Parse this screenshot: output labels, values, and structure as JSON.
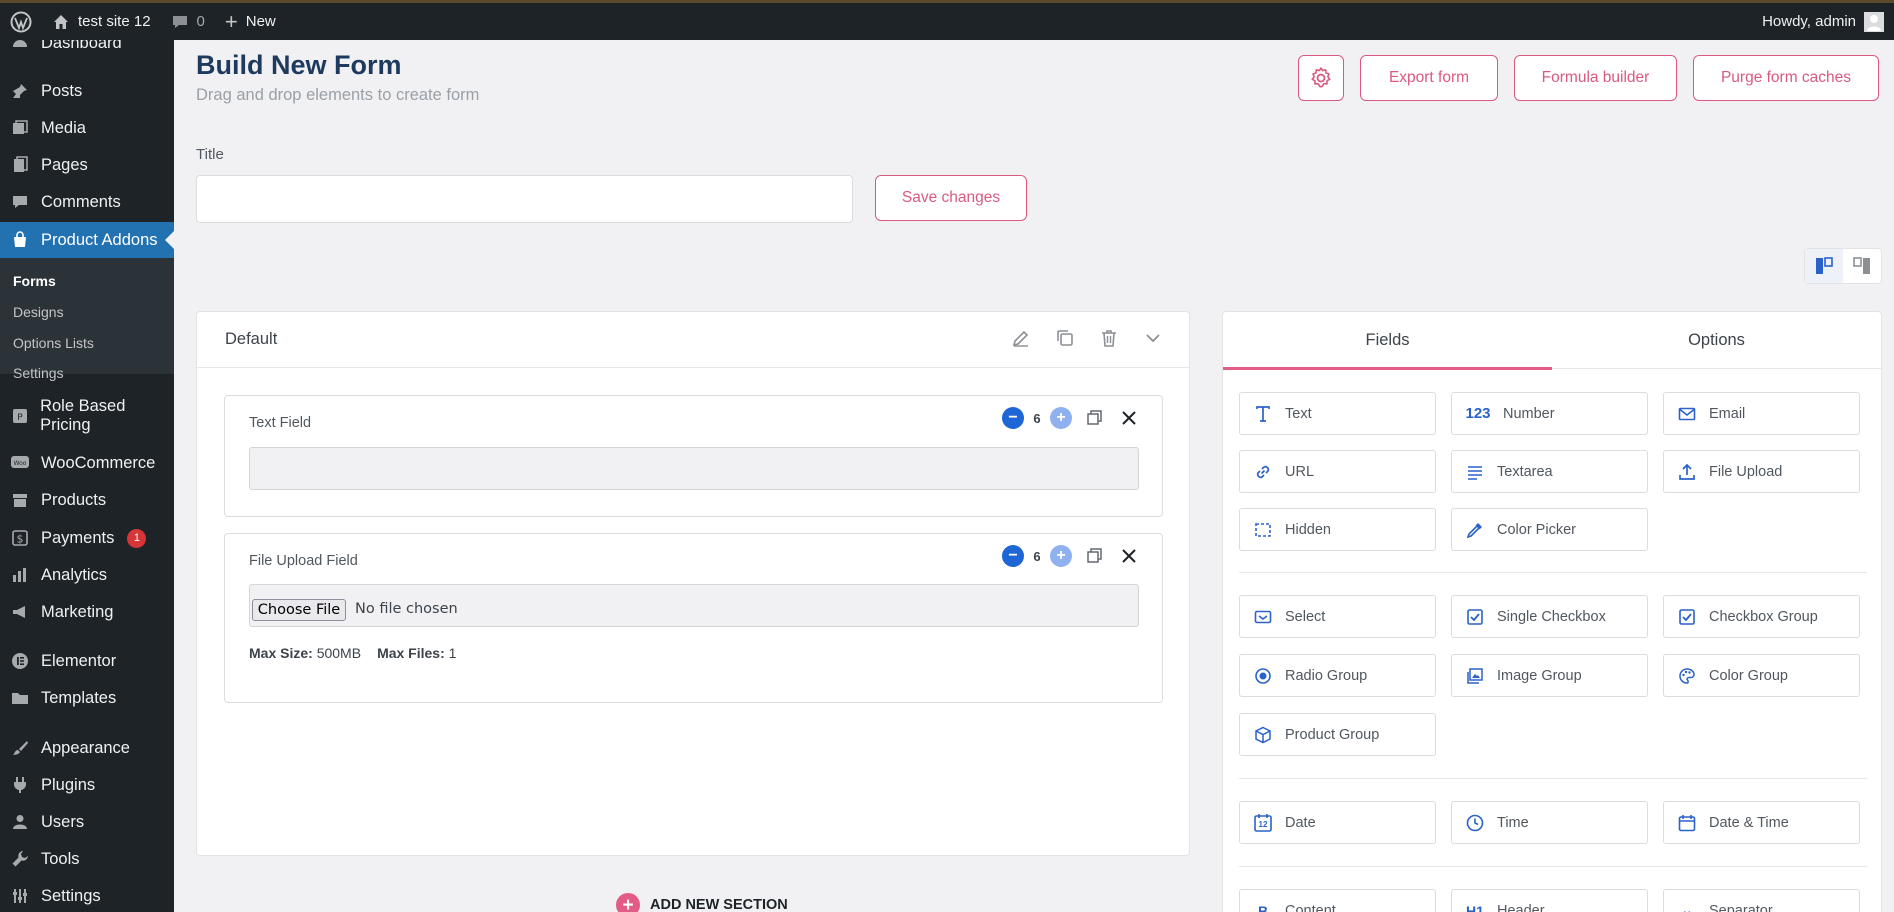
{
  "adminbar": {
    "site_name": "test site 12",
    "comments_count": "0",
    "new_label": "New",
    "howdy": "Howdy, admin"
  },
  "sidebar": {
    "items": [
      {
        "label": "Dashboard",
        "icon": "dashboard-icon"
      },
      {
        "label": "Posts",
        "icon": "pushpin-icon"
      },
      {
        "label": "Media",
        "icon": "media-icon"
      },
      {
        "label": "Pages",
        "icon": "pages-icon"
      },
      {
        "label": "Comments",
        "icon": "comment-icon"
      },
      {
        "label": "Product Addons",
        "icon": "bag-icon"
      },
      {
        "label": "Role Based Pricing",
        "icon": "role-icon"
      },
      {
        "label": "WooCommerce",
        "icon": "woo-icon"
      },
      {
        "label": "Products",
        "icon": "archive-icon"
      },
      {
        "label": "Payments",
        "icon": "dollar-icon",
        "badge": "1"
      },
      {
        "label": "Analytics",
        "icon": "bar-chart-icon"
      },
      {
        "label": "Marketing",
        "icon": "megaphone-icon"
      },
      {
        "label": "Elementor",
        "icon": "elementor-icon"
      },
      {
        "label": "Templates",
        "icon": "folder-icon"
      },
      {
        "label": "Appearance",
        "icon": "brush-icon"
      },
      {
        "label": "Plugins",
        "icon": "plug-icon"
      },
      {
        "label": "Users",
        "icon": "user-icon"
      },
      {
        "label": "Tools",
        "icon": "wrench-icon"
      },
      {
        "label": "Settings",
        "icon": "settings-icon"
      }
    ],
    "submenu": [
      "Forms",
      "Designs",
      "Options Lists",
      "Settings"
    ]
  },
  "header": {
    "title": "Build New Form",
    "subtitle": "Drag and drop elements to create form",
    "buttons": {
      "export": "Export form",
      "formula": "Formula builder",
      "purge": "Purge form caches"
    }
  },
  "form": {
    "title_label": "Title",
    "title_value": "",
    "save_label": "Save changes"
  },
  "section": {
    "name": "Default",
    "fields": [
      {
        "label": "Text Field",
        "columns": "6"
      },
      {
        "label": "File Upload Field",
        "columns": "6",
        "choose_label": "Choose File",
        "no_file": "No file chosen",
        "max_size_label": "Max Size:",
        "max_size": "500MB",
        "max_files_label": "Max Files:",
        "max_files": "1"
      }
    ],
    "add_section": "ADD NEW SECTION"
  },
  "panel": {
    "tabs": [
      "Fields",
      "Options"
    ],
    "tiles": [
      {
        "label": "Text",
        "icon": "text-icon"
      },
      {
        "label": "Number",
        "icon": "number-icon",
        "glyph": "123"
      },
      {
        "label": "Email",
        "icon": "email-icon"
      },
      {
        "label": "URL",
        "icon": "link-icon"
      },
      {
        "label": "Textarea",
        "icon": "textarea-icon"
      },
      {
        "label": "File Upload",
        "icon": "upload-icon"
      },
      {
        "label": "Hidden",
        "icon": "hidden-icon"
      },
      {
        "label": "Color Picker",
        "icon": "eyedropper-icon"
      },
      {
        "label": "Select",
        "icon": "select-icon"
      },
      {
        "label": "Single Checkbox",
        "icon": "checkbox-icon"
      },
      {
        "label": "Checkbox Group",
        "icon": "checkbox-group-icon"
      },
      {
        "label": "Radio Group",
        "icon": "radio-icon"
      },
      {
        "label": "Image Group",
        "icon": "image-icon"
      },
      {
        "label": "Color Group",
        "icon": "palette-icon"
      },
      {
        "label": "Product Group",
        "icon": "box-icon"
      },
      {
        "label": "Date",
        "icon": "calendar-icon",
        "glyph": "12"
      },
      {
        "label": "Time",
        "icon": "clock-icon"
      },
      {
        "label": "Date & Time",
        "icon": "calendar-time-icon"
      },
      {
        "label": "Content",
        "icon": "content-icon"
      },
      {
        "label": "Header",
        "icon": "heading-icon"
      },
      {
        "label": "Separator",
        "icon": "separator-icon"
      }
    ]
  }
}
